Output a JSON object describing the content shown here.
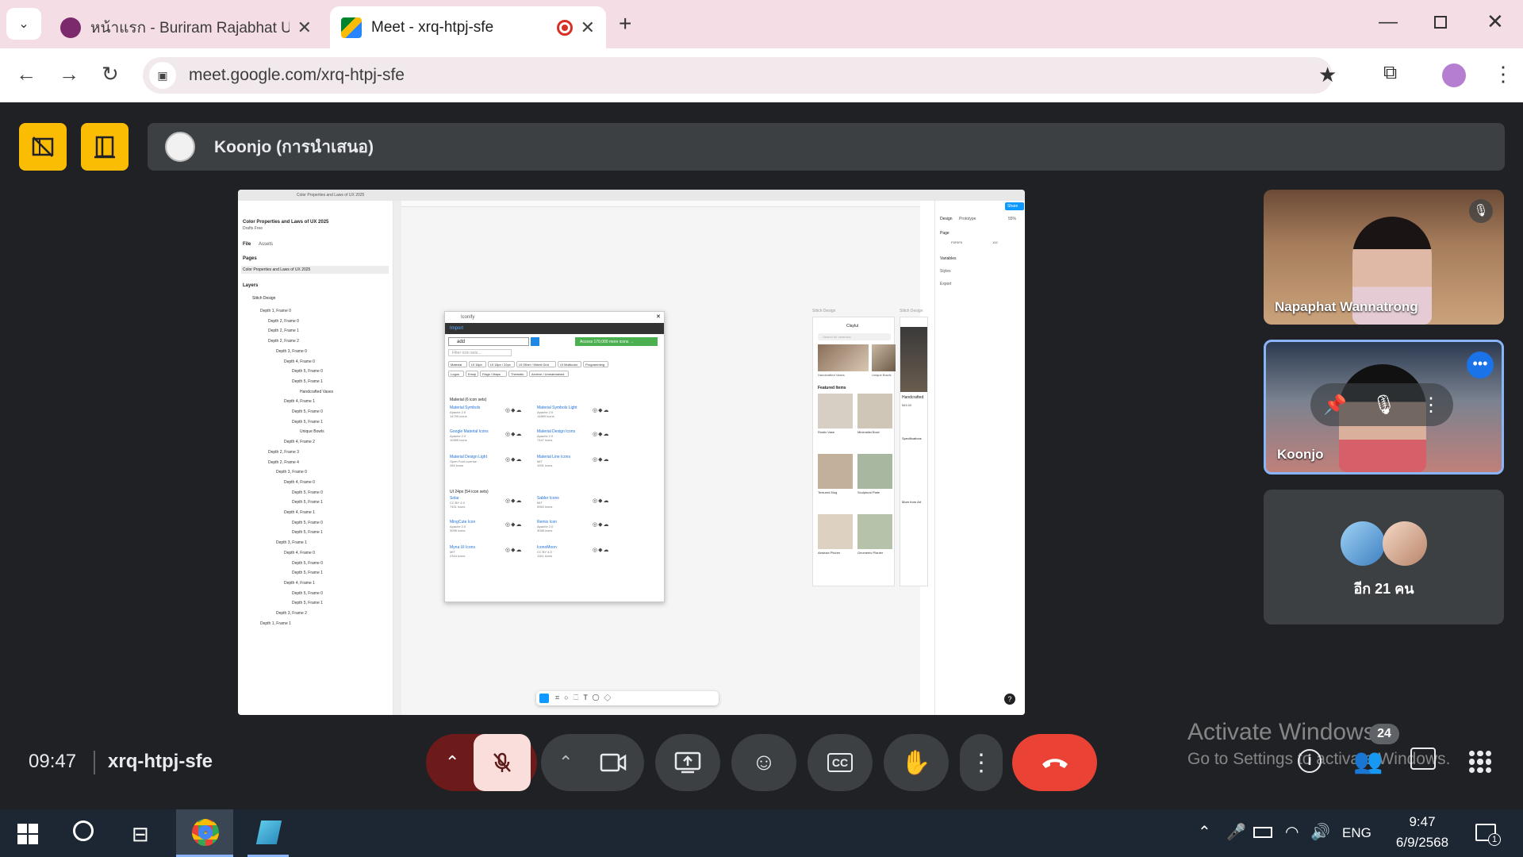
{
  "browser": {
    "tabs": [
      {
        "title": "หน้าแรก - Buriram Rajabhat Univ",
        "active": false
      },
      {
        "title": "Meet - xrq-htpj-sfe",
        "active": true
      }
    ],
    "url": "meet.google.com/xrq-htpj-sfe"
  },
  "meet": {
    "presenter_label": "Koonjo (การนำเสนอ)",
    "participants": [
      {
        "name": "Napaphat Wannatrong",
        "muted": true
      },
      {
        "name": "Koonjo",
        "muted": false
      }
    ],
    "others_label": "อีก 21 คน",
    "time": "09:47",
    "meeting_code": "xrq-htpj-sfe",
    "participant_count": "24"
  },
  "shared_screen": {
    "tab_title": "Color Properties and Laws of UX 2025",
    "file_title": "Color Properties and Laws of UX 2025",
    "plan": "Drafts  Free",
    "file_tab": "File",
    "assets_tab": "Assets",
    "pages_label": "Pages",
    "page_name": "Color Properties and Laws of UX 2025",
    "layers_label": "Layers",
    "root_layer": "Stitch Design",
    "layers": [
      "Depth 1, Frame 0",
      "Depth 2, Frame 0",
      "Depth 2, Frame 1",
      "Depth 2, Frame 2",
      "Depth 3, Frame 0",
      "Depth 4, Frame 0",
      "Depth 5, Frame 0",
      "Depth 5, Frame 1",
      "Handcrafted Vases",
      "Depth 4, Frame 1",
      "Depth 5, Frame 0",
      "Depth 5, Frame 1",
      "Unique Bowls",
      "Depth 4, Frame 2",
      "Depth 2, Frame 3",
      "Depth 2, Frame 4",
      "Depth 3, Frame 0",
      "Depth 4, Frame 0",
      "Depth 5, Frame 0",
      "Depth 5, Frame 1",
      "Depth 4, Frame 1",
      "Depth 5, Frame 0",
      "Depth 5, Frame 1",
      "Depth 3, Frame 1",
      "Depth 4, Frame 0",
      "Depth 5, Frame 0",
      "Depth 5, Frame 1",
      "Depth 4, Frame 1",
      "Depth 5, Frame 0",
      "Depth 5, Frame 1",
      "Depth 3, Frame 2",
      "Depth 1, Frame 1"
    ],
    "plugin": {
      "name": "Iconify",
      "import_label": "Import",
      "search_value": "add",
      "access_button": "Access 170,000 more icons →",
      "filter_placeholder": "Filter icon sets...",
      "chips": [
        "Material",
        "UI 16px",
        "UI 18px / 32px",
        "UI Other / Mixed Grid",
        "UI Multicolor",
        "Programming",
        "Logos",
        "Emoji",
        "Flags / Maps",
        "Thematic",
        "Archive / Unmaintained"
      ],
      "section1": "Material (6 icon sets)",
      "section2": "UI 24px (54 icon sets)",
      "sets": [
        {
          "name": "Material Symbols",
          "license": "Apache 2.0",
          "count": "14799 icons"
        },
        {
          "name": "Material Symbols Light",
          "license": "Apache 2.0",
          "count": "14869 icons"
        },
        {
          "name": "Google Material Icons",
          "license": "Apache 2.0",
          "count": "10955 icons"
        },
        {
          "name": "Material Design Icons",
          "license": "Apache 2.0",
          "count": "7447 icons"
        },
        {
          "name": "Material Design Light",
          "license": "Open Font License",
          "count": "284 icons"
        },
        {
          "name": "Material Line Icons",
          "license": "MIT",
          "count": "1091 icons"
        },
        {
          "name": "Solar",
          "license": "CC BY 4.0",
          "count": "7401 icons"
        },
        {
          "name": "Sabler Icons",
          "license": "MIT",
          "count": "5963 icons"
        },
        {
          "name": "MingCute Icon",
          "license": "Apache 2.0",
          "count": "3098 icons"
        },
        {
          "name": "Remix Icon",
          "license": "Apache 2.0",
          "count": "3058 icons"
        },
        {
          "name": "Myna UI Icons",
          "license": "MIT",
          "count": "2344 icons"
        },
        {
          "name": "IconoMoon",
          "license": "CC BY 4.0",
          "count": "1161 icons"
        }
      ]
    },
    "mockup": {
      "frame_label": "Stitch Design",
      "app_title": "Claylul",
      "search_placeholder": "Search for ceramics",
      "cards": [
        "Handcrafted Vases",
        "Unique Bowls"
      ],
      "featured": "Featured Items",
      "items": [
        "Rustic Vase",
        "Minimalist Bowl",
        "Textured Mug",
        "Sculptural Plate",
        "Abstract Pitcher",
        "Geometric Planter"
      ],
      "detail_title": "Handcrafted",
      "detail_price": "$45.00",
      "spec_label": "Specifications",
      "more_label": "More from Art"
    },
    "right_panel": {
      "share": "Share",
      "design_tab": "Design",
      "prototype_tab": "Prototype",
      "zoom": "55%",
      "page_label": "Page",
      "page_color": "F5F5F5",
      "page_opacity": "100",
      "variables": "Variables",
      "styles": "Styles",
      "export": "Export"
    }
  },
  "desktop": {
    "watermark_line1": "Activate Windows",
    "watermark_line2": "Go to Settings to activate Windows.",
    "language": "ENG",
    "clock_time": "9:47",
    "clock_date": "6/9/2568",
    "notification_count": "1"
  },
  "colors": {
    "meet_bg": "#202124",
    "yellow": "#fbbc04",
    "end_call": "#ea4335",
    "mic_muted": "#f9dedc",
    "tab_strip": "#f5dde5"
  }
}
